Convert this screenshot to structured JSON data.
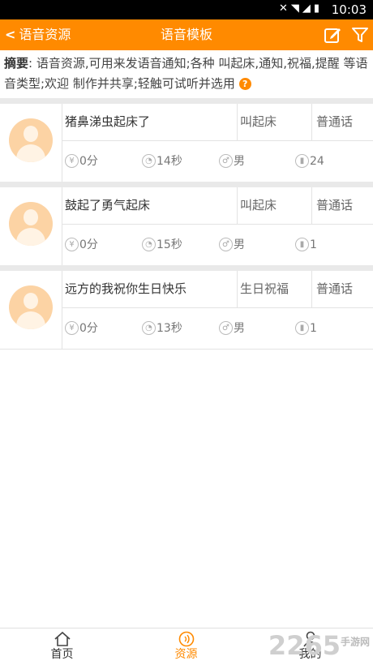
{
  "status_bar": {
    "time": "10:03",
    "icons": "mute-icon wifi-icon signal-icon battery-icon"
  },
  "header": {
    "back_label": "语音资源",
    "title": "语音模板",
    "accent": "#ff8a00"
  },
  "summary": {
    "label": "摘要",
    "text": ": 语音资源,可用来发语音通知;各种 叫起床,通知,祝福,提醒 等语音类型;欢迎 制作并共享;轻触可试听并选用"
  },
  "items": [
    {
      "title": "猪鼻涕虫起床了",
      "type": "叫起床",
      "language": "普通话",
      "price": "0分",
      "duration": "14秒",
      "gender": "男",
      "plays": "24"
    },
    {
      "title": "鼓起了勇气起床",
      "type": "叫起床",
      "language": "普通话",
      "price": "0分",
      "duration": "15秒",
      "gender": "男",
      "plays": "1"
    },
    {
      "title": "远方的我祝你生日快乐",
      "type": "生日祝福",
      "language": "普通话",
      "price": "0分",
      "duration": "13秒",
      "gender": "男",
      "plays": "1"
    }
  ],
  "bottom_nav": [
    {
      "label": "首页",
      "icon": "home-icon",
      "active": false
    },
    {
      "label": "资源",
      "icon": "sound-icon",
      "active": true
    },
    {
      "label": "我的",
      "icon": "user-icon",
      "active": false
    }
  ],
  "watermark": {
    "text": "2265",
    "sub": "手游网"
  }
}
